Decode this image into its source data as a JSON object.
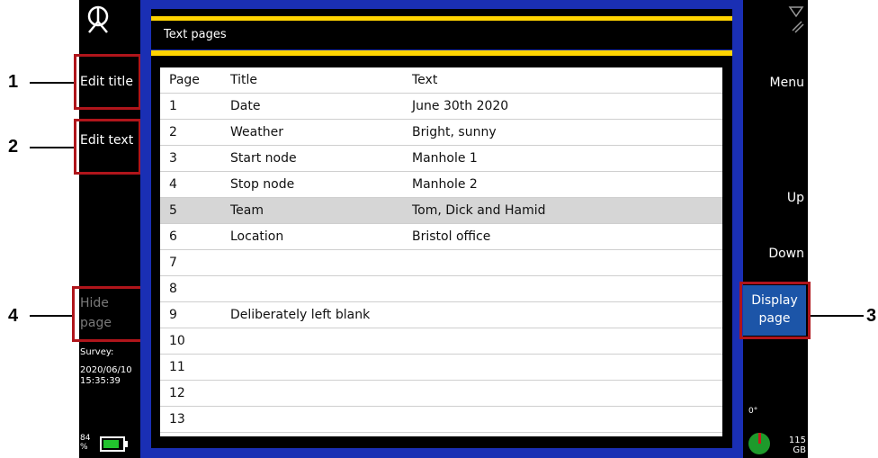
{
  "header": {
    "title": "Text pages"
  },
  "left_softkeys": {
    "edit_title": "Edit title",
    "edit_text": "Edit text",
    "hide_page_line1": "Hide",
    "hide_page_line2": "page"
  },
  "status": {
    "survey_label": "Survey:",
    "survey_date": "2020/06/10",
    "survey_time": "15:35:39",
    "battery_pct_top": "84",
    "battery_pct_unit": "%",
    "battery_level": 0.84,
    "heading": "0°",
    "disk_free_value": "115",
    "disk_free_unit": "GB"
  },
  "right_softkeys": {
    "menu": "Menu",
    "up": "Up",
    "down": "Down",
    "display_page_line1": "Display",
    "display_page_line2": "page"
  },
  "table": {
    "columns": [
      "Page",
      "Title",
      "Text"
    ],
    "rows": [
      {
        "page": "1",
        "title": "Date",
        "text": "June 30th 2020"
      },
      {
        "page": "2",
        "title": "Weather",
        "text": "Bright, sunny"
      },
      {
        "page": "3",
        "title": "Start node",
        "text": "Manhole 1"
      },
      {
        "page": "4",
        "title": "Stop node",
        "text": "Manhole 2"
      },
      {
        "page": "5",
        "title": "Team",
        "text": "Tom, Dick and Hamid"
      },
      {
        "page": "6",
        "title": "Location",
        "text": "Bristol office"
      },
      {
        "page": "7",
        "title": "",
        "text": ""
      },
      {
        "page": "8",
        "title": "",
        "text": ""
      },
      {
        "page": "9",
        "title": "Deliberately left blank",
        "text": ""
      },
      {
        "page": "10",
        "title": "",
        "text": ""
      },
      {
        "page": "11",
        "title": "",
        "text": ""
      },
      {
        "page": "12",
        "title": "",
        "text": ""
      },
      {
        "page": "13",
        "title": "",
        "text": ""
      }
    ],
    "selected_page": "5"
  },
  "callouts": [
    "1",
    "2",
    "3",
    "4"
  ],
  "colors": {
    "screen_blue": "#1a2fb4",
    "accent_yellow": "#ffd400",
    "callout_red": "#b0151b",
    "button_blue": "#1c55a8",
    "battery_green": "#22c22e"
  }
}
